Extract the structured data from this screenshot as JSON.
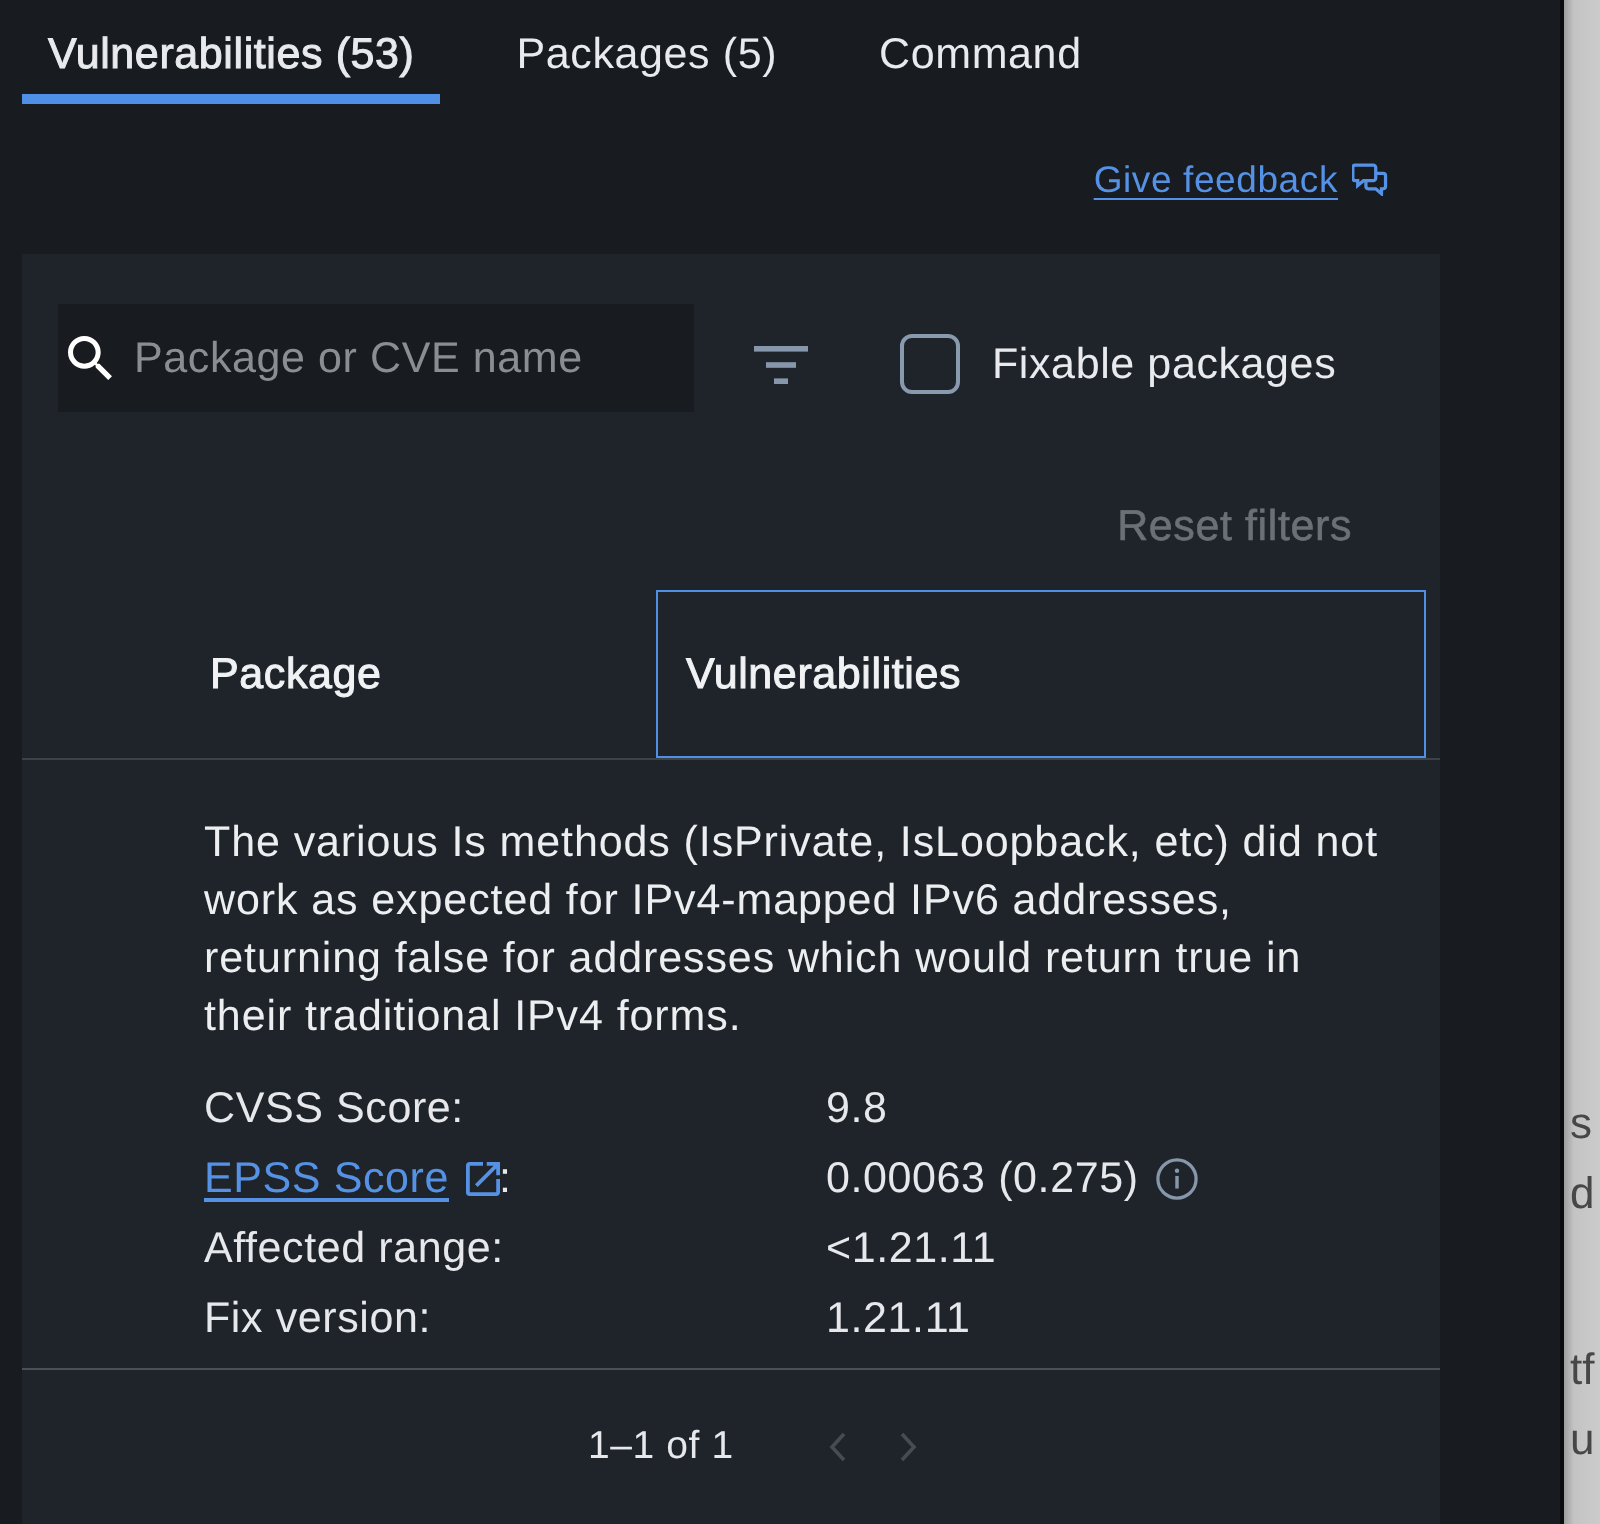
{
  "tabs": [
    {
      "label": "Vulnerabilities (53)",
      "selected": true
    },
    {
      "label": "Packages (5)",
      "selected": false
    },
    {
      "label": "Command",
      "selected": false
    }
  ],
  "feedback_link": {
    "label": "Give feedback"
  },
  "filters": {
    "search": {
      "placeholder": "Package or CVE name"
    },
    "fixable": {
      "label": "Fixable packages",
      "checked": false
    },
    "reset_button": {
      "label": "Reset filters",
      "disabled": true
    }
  },
  "table": {
    "columns": [
      {
        "label": "Package",
        "focused": false
      },
      {
        "label": "Vulnerabilities",
        "focused": true
      }
    ],
    "expanded_row": {
      "description": "The various Is methods (IsPrivate, IsLoopback, etc) did not work as expected for IPv4-mapped IPv6 addresses, returning false for addresses which would return true in their traditional IPv4 forms.",
      "details": [
        {
          "kind": "text",
          "label": "CVSS Score:",
          "value": "9.8",
          "info": false
        },
        {
          "kind": "link",
          "label": "EPSS Score",
          "suffix": ":",
          "value": "0.00063 (0.275)",
          "info": true
        },
        {
          "kind": "text",
          "label": "Affected range:",
          "value": "<1.21.11",
          "info": false
        },
        {
          "kind": "text",
          "label": "Fix version:",
          "value": "1.21.11",
          "info": false
        }
      ]
    }
  },
  "pagination": {
    "range": "1–1 of 1",
    "previous_disabled": true,
    "next_disabled": true
  },
  "background_page": {
    "paragraphs": [
      [
        "s",
        "d"
      ],
      [
        "tf",
        "u"
      ]
    ]
  }
}
